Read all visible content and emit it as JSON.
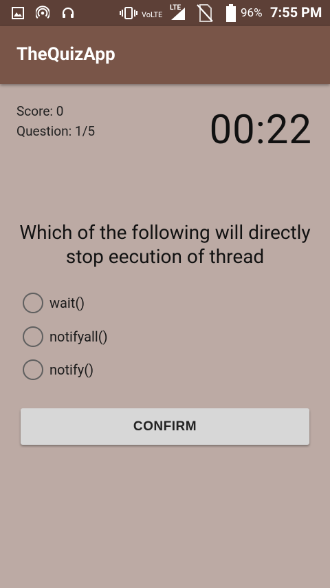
{
  "status_bar": {
    "icons": [
      "image-icon",
      "hotspot-icon",
      "headset-icon",
      "vibrate-icon",
      "volte-label",
      "lte-signal-icon",
      "no-sim-icon",
      "battery-icon"
    ],
    "volte": "VoLTE",
    "lte": "LTE",
    "battery": "96%",
    "time": "7:55 PM"
  },
  "app_bar": {
    "title": "TheQuizApp",
    "color": "#795548"
  },
  "quiz": {
    "score": "Score: 0",
    "question_count": "Question: 1/5",
    "timer": "00:22",
    "question": "Which of the following will directly stop eecution of thread",
    "options": [
      {
        "label": "wait()",
        "selected": false
      },
      {
        "label": "notifyall()",
        "selected": false
      },
      {
        "label": "notify()",
        "selected": false
      }
    ],
    "confirm_label": "CONFIRM"
  },
  "colors": {
    "status_bar": "#5d4037",
    "background": "#bcaaa4",
    "button": "#d7d7d7"
  }
}
